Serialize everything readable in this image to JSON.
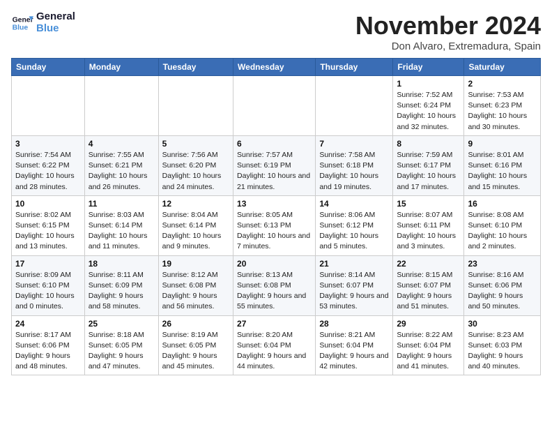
{
  "logo": {
    "line1": "General",
    "line2": "Blue"
  },
  "title": "November 2024",
  "subtitle": "Don Alvaro, Extremadura, Spain",
  "days_of_week": [
    "Sunday",
    "Monday",
    "Tuesday",
    "Wednesday",
    "Thursday",
    "Friday",
    "Saturday"
  ],
  "weeks": [
    [
      {
        "num": "",
        "info": ""
      },
      {
        "num": "",
        "info": ""
      },
      {
        "num": "",
        "info": ""
      },
      {
        "num": "",
        "info": ""
      },
      {
        "num": "",
        "info": ""
      },
      {
        "num": "1",
        "info": "Sunrise: 7:52 AM\nSunset: 6:24 PM\nDaylight: 10 hours and 32 minutes."
      },
      {
        "num": "2",
        "info": "Sunrise: 7:53 AM\nSunset: 6:23 PM\nDaylight: 10 hours and 30 minutes."
      }
    ],
    [
      {
        "num": "3",
        "info": "Sunrise: 7:54 AM\nSunset: 6:22 PM\nDaylight: 10 hours and 28 minutes."
      },
      {
        "num": "4",
        "info": "Sunrise: 7:55 AM\nSunset: 6:21 PM\nDaylight: 10 hours and 26 minutes."
      },
      {
        "num": "5",
        "info": "Sunrise: 7:56 AM\nSunset: 6:20 PM\nDaylight: 10 hours and 24 minutes."
      },
      {
        "num": "6",
        "info": "Sunrise: 7:57 AM\nSunset: 6:19 PM\nDaylight: 10 hours and 21 minutes."
      },
      {
        "num": "7",
        "info": "Sunrise: 7:58 AM\nSunset: 6:18 PM\nDaylight: 10 hours and 19 minutes."
      },
      {
        "num": "8",
        "info": "Sunrise: 7:59 AM\nSunset: 6:17 PM\nDaylight: 10 hours and 17 minutes."
      },
      {
        "num": "9",
        "info": "Sunrise: 8:01 AM\nSunset: 6:16 PM\nDaylight: 10 hours and 15 minutes."
      }
    ],
    [
      {
        "num": "10",
        "info": "Sunrise: 8:02 AM\nSunset: 6:15 PM\nDaylight: 10 hours and 13 minutes."
      },
      {
        "num": "11",
        "info": "Sunrise: 8:03 AM\nSunset: 6:14 PM\nDaylight: 10 hours and 11 minutes."
      },
      {
        "num": "12",
        "info": "Sunrise: 8:04 AM\nSunset: 6:14 PM\nDaylight: 10 hours and 9 minutes."
      },
      {
        "num": "13",
        "info": "Sunrise: 8:05 AM\nSunset: 6:13 PM\nDaylight: 10 hours and 7 minutes."
      },
      {
        "num": "14",
        "info": "Sunrise: 8:06 AM\nSunset: 6:12 PM\nDaylight: 10 hours and 5 minutes."
      },
      {
        "num": "15",
        "info": "Sunrise: 8:07 AM\nSunset: 6:11 PM\nDaylight: 10 hours and 3 minutes."
      },
      {
        "num": "16",
        "info": "Sunrise: 8:08 AM\nSunset: 6:10 PM\nDaylight: 10 hours and 2 minutes."
      }
    ],
    [
      {
        "num": "17",
        "info": "Sunrise: 8:09 AM\nSunset: 6:10 PM\nDaylight: 10 hours and 0 minutes."
      },
      {
        "num": "18",
        "info": "Sunrise: 8:11 AM\nSunset: 6:09 PM\nDaylight: 9 hours and 58 minutes."
      },
      {
        "num": "19",
        "info": "Sunrise: 8:12 AM\nSunset: 6:08 PM\nDaylight: 9 hours and 56 minutes."
      },
      {
        "num": "20",
        "info": "Sunrise: 8:13 AM\nSunset: 6:08 PM\nDaylight: 9 hours and 55 minutes."
      },
      {
        "num": "21",
        "info": "Sunrise: 8:14 AM\nSunset: 6:07 PM\nDaylight: 9 hours and 53 minutes."
      },
      {
        "num": "22",
        "info": "Sunrise: 8:15 AM\nSunset: 6:07 PM\nDaylight: 9 hours and 51 minutes."
      },
      {
        "num": "23",
        "info": "Sunrise: 8:16 AM\nSunset: 6:06 PM\nDaylight: 9 hours and 50 minutes."
      }
    ],
    [
      {
        "num": "24",
        "info": "Sunrise: 8:17 AM\nSunset: 6:06 PM\nDaylight: 9 hours and 48 minutes."
      },
      {
        "num": "25",
        "info": "Sunrise: 8:18 AM\nSunset: 6:05 PM\nDaylight: 9 hours and 47 minutes."
      },
      {
        "num": "26",
        "info": "Sunrise: 8:19 AM\nSunset: 6:05 PM\nDaylight: 9 hours and 45 minutes."
      },
      {
        "num": "27",
        "info": "Sunrise: 8:20 AM\nSunset: 6:04 PM\nDaylight: 9 hours and 44 minutes."
      },
      {
        "num": "28",
        "info": "Sunrise: 8:21 AM\nSunset: 6:04 PM\nDaylight: 9 hours and 42 minutes."
      },
      {
        "num": "29",
        "info": "Sunrise: 8:22 AM\nSunset: 6:04 PM\nDaylight: 9 hours and 41 minutes."
      },
      {
        "num": "30",
        "info": "Sunrise: 8:23 AM\nSunset: 6:03 PM\nDaylight: 9 hours and 40 minutes."
      }
    ]
  ]
}
